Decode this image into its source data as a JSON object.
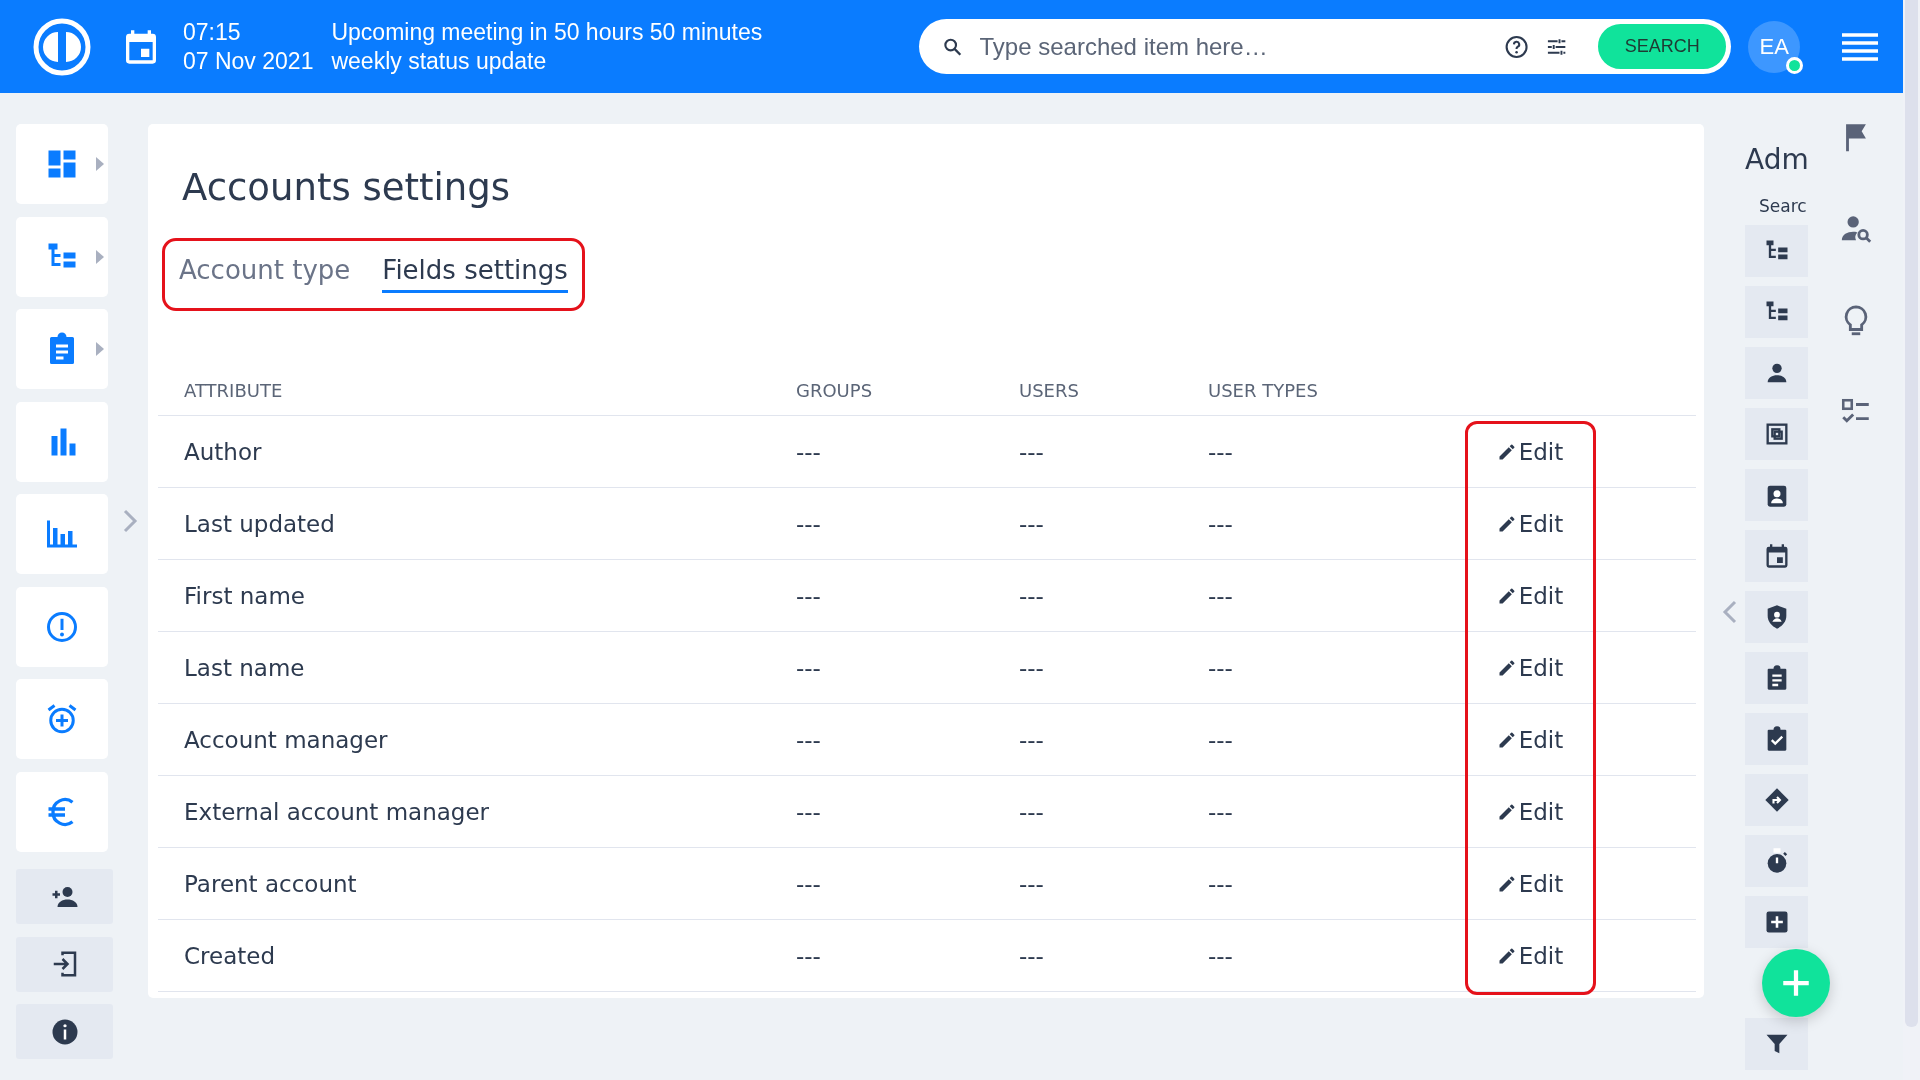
{
  "top_bar": {
    "time": "07:15",
    "meeting": "Upcoming meeting in 50 hours 50 minutes",
    "date": "07 Nov 2021",
    "event": "weekly status update",
    "search": {
      "placeholder": "Type searched item here…",
      "button": "SEARCH"
    },
    "avatar": {
      "initials": "EA",
      "online": true
    }
  },
  "left_nav": [
    {
      "expandable": true
    },
    {
      "expandable": true
    },
    {
      "expandable": true
    },
    {
      "expandable": false
    },
    {
      "expandable": false
    },
    {
      "expandable": false
    },
    {
      "expandable": false
    },
    {
      "expandable": false
    }
  ],
  "page": {
    "title": "Accounts settings",
    "tabs": [
      {
        "label": "Account type",
        "selected": false
      },
      {
        "label": "Fields settings",
        "selected": true
      }
    ],
    "table": {
      "columns": [
        "ATTRIBUTE",
        "GROUPS",
        "USERS",
        "USER TYPES"
      ],
      "rows": [
        {
          "attribute": "Author",
          "groups": "---",
          "users": "---",
          "user_types": "---",
          "action": "Edit"
        },
        {
          "attribute": "Last updated",
          "groups": "---",
          "users": "---",
          "user_types": "---",
          "action": "Edit"
        },
        {
          "attribute": "First name",
          "groups": "---",
          "users": "---",
          "user_types": "---",
          "action": "Edit"
        },
        {
          "attribute": "Last name",
          "groups": "---",
          "users": "---",
          "user_types": "---",
          "action": "Edit"
        },
        {
          "attribute": "Account manager",
          "groups": "---",
          "users": "---",
          "user_types": "---",
          "action": "Edit"
        },
        {
          "attribute": "External account manager",
          "groups": "---",
          "users": "---",
          "user_types": "---",
          "action": "Edit"
        },
        {
          "attribute": "Parent account",
          "groups": "---",
          "users": "---",
          "user_types": "---",
          "action": "Edit"
        },
        {
          "attribute": "Created",
          "groups": "---",
          "users": "---",
          "user_types": "---",
          "action": "Edit"
        }
      ]
    }
  },
  "admin_panel": {
    "title": "Adm",
    "search_label": "Searc"
  }
}
